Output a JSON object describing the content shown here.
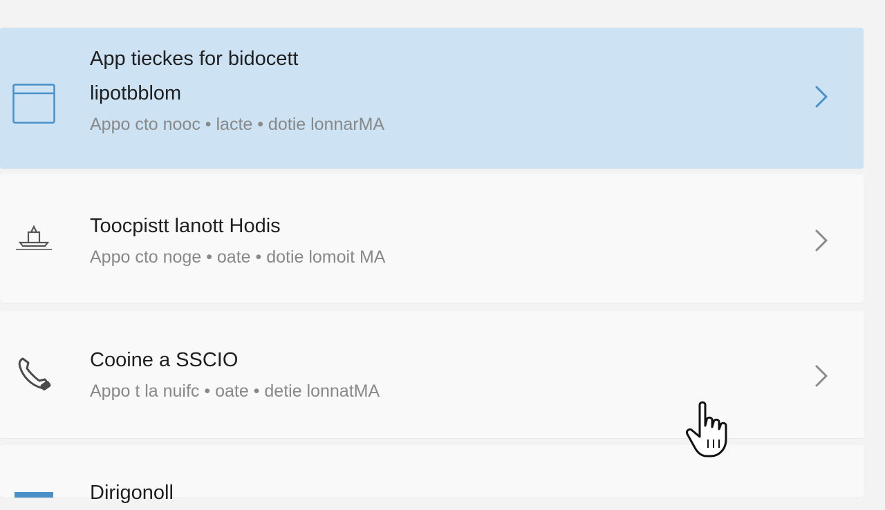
{
  "rows": [
    {
      "title": "App tieckes for bidocett",
      "title2": "lipotbblom",
      "subtitle": "Appo cto nooc • lacte • dotie lonnarMA",
      "icon": "window-icon",
      "selected": true
    },
    {
      "title": "Toocpistt lanott Hodis",
      "subtitle": "Appo cto noge • oate • dotie lomoit MA",
      "icon": "boat-icon",
      "selected": false
    },
    {
      "title": "Cooine a SSCIO",
      "subtitle": "Appo t la nuifc • oate • detie lonnatMA",
      "icon": "phone-icon",
      "selected": false
    },
    {
      "title": "Dirigonoll",
      "subtitle": "",
      "icon": "window-icon",
      "selected": false
    }
  ],
  "colors": {
    "selected_bg": "#cde3f4",
    "row_bg": "#f9f9f9",
    "accent": "#4a90c8"
  }
}
